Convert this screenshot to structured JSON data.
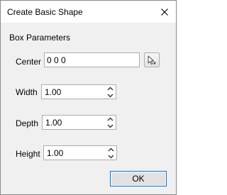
{
  "window": {
    "title": "Create Basic Shape"
  },
  "group": {
    "label": "Box Parameters"
  },
  "fields": {
    "center": {
      "label": "Center",
      "value": "0 0 0"
    },
    "width": {
      "label": "Width",
      "value": "1.00"
    },
    "depth": {
      "label": "Depth",
      "value": "1.00"
    },
    "height": {
      "label": "Height",
      "value": "1.00"
    }
  },
  "buttons": {
    "ok_label": "OK"
  },
  "icons": {
    "close": "close-icon",
    "pick": "pick-point-cursor-icon",
    "spin_up": "chevron-up-icon",
    "spin_down": "chevron-down-icon"
  },
  "colors": {
    "dialog_background": "#f0f0f0",
    "titlebar_background": "#ffffff",
    "default_button_border": "#0078d7"
  }
}
